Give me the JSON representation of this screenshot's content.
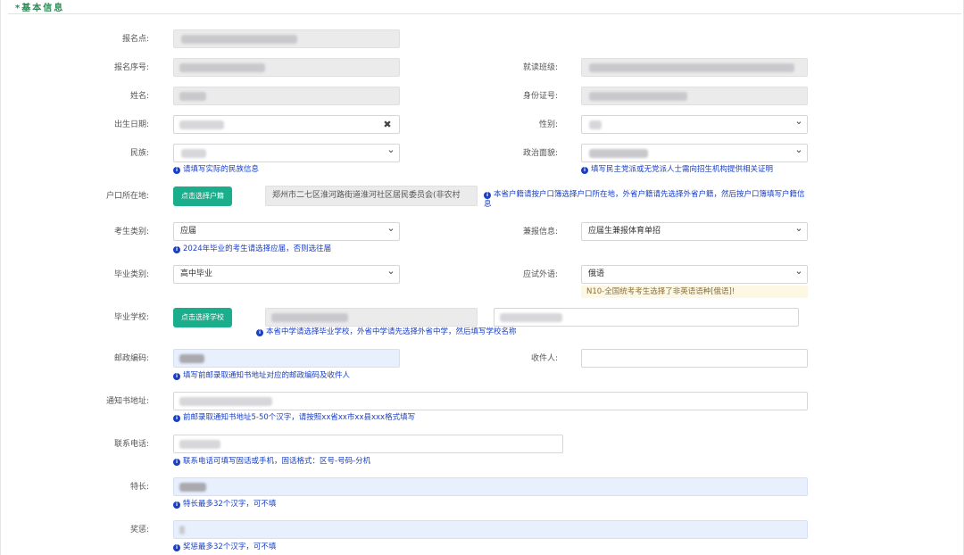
{
  "section": {
    "mark": "*",
    "title": "基本信息"
  },
  "fields": {
    "site": {
      "label": "报名点:"
    },
    "serial": {
      "label": "报名序号:"
    },
    "class": {
      "label": "就读班级:"
    },
    "name": {
      "label": "姓名:"
    },
    "idcard": {
      "label": "身份证号:"
    },
    "birth": {
      "label": "出生日期:"
    },
    "gender": {
      "label": "性别:"
    },
    "ethnic": {
      "label": "民族:",
      "hint": "请填写实际的民族信息"
    },
    "political": {
      "label": "政治面貌:",
      "hint": "填写民主党派或无党派人士需向招生机构提供相关证明"
    },
    "hukou": {
      "label": "户口所在地:",
      "button": "点击选择户籍",
      "value": "郑州市二七区淮河路街道淮河社区居民委员会(非农村",
      "hint": "本省户籍请按户口簿选择户口所在地，外省户籍请先选择外省户籍，然后按户口簿填写户籍信息"
    },
    "exam_type": {
      "label": "考生类别:",
      "value": "应届",
      "hint": "2024年毕业的考生请选择应届，否则选往届"
    },
    "report_info": {
      "label": "兼报信息:",
      "value": "应届生兼报体育单招"
    },
    "grad_type": {
      "label": "毕业类别:",
      "value": "高中毕业"
    },
    "language": {
      "label": "应试外语:",
      "value": "俄语",
      "warning": "N10-全国统考考生选择了非英语语种[俄语]!"
    },
    "school": {
      "label": "毕业学校:",
      "button": "点击选择学校",
      "hint": "本省中学请选择毕业学校，外省中学请先选择外省中学，然后填写学校名称"
    },
    "postcode": {
      "label": "邮政编码:",
      "hint": "填写前邮录取通知书地址对应的邮政编码及收件人"
    },
    "recipient": {
      "label": "收件人:"
    },
    "address": {
      "label": "通知书地址:",
      "hint": "前邮录取通知书地址5-50个汉字，请按照xx省xx市xx县xxx格式填写"
    },
    "phone": {
      "label": "联系电话:",
      "hint": "联系电话可填写固话或手机，固话格式：区号-号码-分机"
    },
    "specialty": {
      "label": "特长:",
      "hint": "特长最多32个汉字，可不填"
    },
    "awards": {
      "label": "奖惩:",
      "hint": "奖惩最多32个汉字，可不填"
    }
  },
  "icons": {
    "info": "info-circle-icon",
    "clear": "close-icon",
    "dropdown": "chevron-down-icon"
  },
  "colors": {
    "accent_green": "#1aae8c",
    "section_title": "#2e8b57",
    "hint_blue": "#1a3fc2",
    "warning_bg": "#fcf8e3"
  }
}
